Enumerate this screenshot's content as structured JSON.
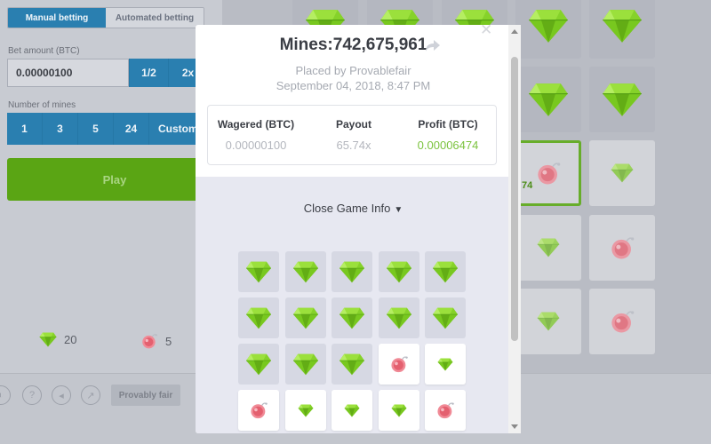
{
  "app": {
    "tabs": [
      {
        "label": "Manual betting",
        "active": true
      },
      {
        "label": "Automated betting",
        "active": false
      }
    ],
    "bet_amount_label": "Bet amount (BTC)",
    "bet_amount_value": "0.00000100",
    "half_label": "1/2",
    "double_label": "2x",
    "mines_label": "Number of mines",
    "mine_options": [
      "1",
      "3",
      "5",
      "24",
      "Custom"
    ],
    "play_label": "Play",
    "gems_count": "20",
    "mines_count": "5",
    "provably_fair_label": "Provably fair",
    "board_multiplier": "74",
    "colors": {
      "accent": "#2a7fb0",
      "play": "#5aa514",
      "profit": "#7cc33f"
    }
  },
  "modal": {
    "title": "Mines:742,675,961",
    "placed_by": "Placed by Provablefair",
    "date": "September 04, 2018, 8:47 PM",
    "stats": [
      {
        "label": "Wagered (BTC)",
        "value": "0.00000100"
      },
      {
        "label": "Payout",
        "value": "65.74x"
      },
      {
        "label": "Profit (BTC)",
        "value": "0.00006474"
      }
    ],
    "close_info_label": "Close Game Info",
    "grid": [
      [
        "gem",
        "gem",
        "gem",
        "gem",
        "gem"
      ],
      [
        "gem",
        "gem",
        "gem",
        "gem",
        "gem"
      ],
      [
        "gem",
        "gem",
        "gem",
        "mine-revealed",
        "gem-revealed"
      ],
      [
        "mine-revealed",
        "gem-revealed",
        "gem-revealed",
        "gem-revealed",
        "mine-revealed"
      ]
    ]
  }
}
